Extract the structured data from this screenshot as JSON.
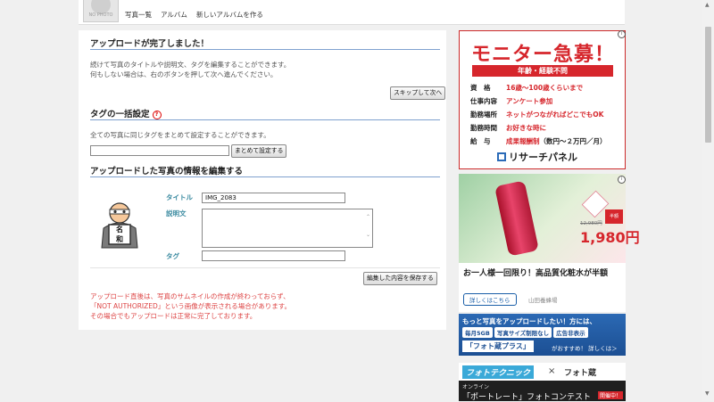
{
  "header": {
    "avatar_label": "NO PHOTO",
    "nav": [
      "写真一覧",
      "アルバム",
      "新しいアルバムを作る"
    ]
  },
  "upload_done": {
    "title": "アップロードが完了しました！",
    "desc1": "続けて写真のタイトルや説明文、タグを編集することができます。",
    "desc2": "何もしない場合は、右のボタンを押して次へ進んでください。",
    "skip_button": "スキップして次へ"
  },
  "tag_bulk": {
    "title": "タグの一括設定",
    "help_icon": "?",
    "desc": "全ての写真に同じタグをまとめて設定することができます。",
    "input_value": "",
    "set_button": "まとめて設定する"
  },
  "edit": {
    "title": "アップロードした写真の情報を編集する",
    "title_label": "タイトル",
    "title_value": "IMG_2083",
    "desc_label": "説明文",
    "desc_value": "",
    "tag_label": "タグ",
    "tag_value": "",
    "save_button": "編集した内容を保存する",
    "thumb_text": "名和"
  },
  "notice": {
    "line1": "アップロード直後は、写真のサムネイルの作成が終わっておらず、",
    "line2": "「NOT AUTHORIZED」という画像が表示される場合があります。",
    "line3": "その場合でもアップロードは正常に完了しております。"
  },
  "ads": {
    "info": "i",
    "monitor": {
      "title": "モニター急募！",
      "subtitle": "年齢・経験不問",
      "rows": [
        {
          "k": "資　格",
          "v": "16歳〜100歳くらいまで",
          "v_extra": ""
        },
        {
          "k": "仕事内容",
          "v": "アンケート参加",
          "v_extra": ""
        },
        {
          "k": "勤務場所",
          "v": "ネットがつながればどこでもOK",
          "v_extra": ""
        },
        {
          "k": "勤務時間",
          "v": "お好きな時に",
          "v_extra": ""
        },
        {
          "k": "給　与",
          "v": "成果報酬制",
          "v_extra": "（数円〜２万円／月）"
        }
      ],
      "logo": "リサーチパネル"
    },
    "cosme": {
      "old_price": "12,980円",
      "price": "1,980円",
      "badge": "半額",
      "caption": "お一人様一回限り！高品質化粧水が半額",
      "more": "詳しくはこちら",
      "source": "山田養蜂場"
    },
    "fotozo": {
      "line1": "もっと写真をアップロードしたい！方には、",
      "pills": [
        "毎月5GB",
        "写真サイズ制限なし",
        "広告非表示"
      ],
      "name": "「フォト蔵プラス」",
      "recommend": "がおすすめ！ 詳しくは＞"
    },
    "contest": {
      "logo1": "フォトテクニック",
      "x": "×",
      "logo2": "フォト蔵",
      "online": "オンライン",
      "title": "「ポートレート」フォトコンテスト",
      "status": "開催中！"
    }
  }
}
